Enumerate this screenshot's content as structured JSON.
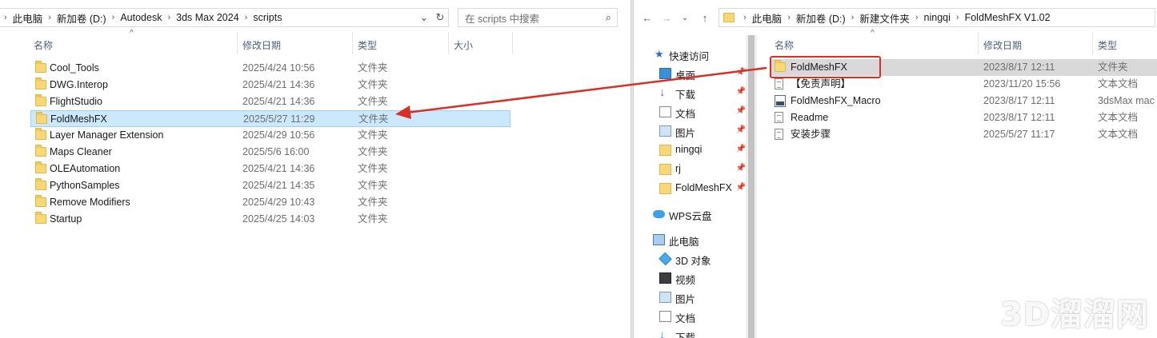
{
  "left": {
    "breadcrumb": [
      "此电脑",
      "新加卷 (D:)",
      "Autodesk",
      "3ds Max 2024",
      "scripts"
    ],
    "search_placeholder": "在 scripts 中搜索",
    "columns": {
      "name": "名称",
      "date": "修改日期",
      "type": "类型",
      "size": "大小"
    },
    "rows": [
      {
        "name": "Cool_Tools",
        "date": "2025/4/24 10:56",
        "type": "文件夹"
      },
      {
        "name": "DWG.Interop",
        "date": "2025/4/21 14:36",
        "type": "文件夹"
      },
      {
        "name": "FlightStudio",
        "date": "2025/4/21 14:36",
        "type": "文件夹"
      },
      {
        "name": "FoldMeshFX",
        "date": "2025/5/27 11:29",
        "type": "文件夹"
      },
      {
        "name": "Layer Manager Extension",
        "date": "2025/4/29 10:56",
        "type": "文件夹"
      },
      {
        "name": "Maps Cleaner",
        "date": "2025/5/6 16:00",
        "type": "文件夹"
      },
      {
        "name": "OLEAutomation",
        "date": "2025/4/21 14:36",
        "type": "文件夹"
      },
      {
        "name": "PythonSamples",
        "date": "2025/4/21 14:35",
        "type": "文件夹"
      },
      {
        "name": "Remove Modifiers",
        "date": "2025/4/29 10:43",
        "type": "文件夹"
      },
      {
        "name": "Startup",
        "date": "2025/4/25 14:03",
        "type": "文件夹"
      }
    ]
  },
  "right": {
    "breadcrumb": [
      "此电脑",
      "新加卷 (D:)",
      "新建文件夹",
      "ningqi",
      "FoldMeshFX V1.02"
    ],
    "columns": {
      "name": "名称",
      "date": "修改日期",
      "type": "类型"
    },
    "nav": {
      "quick_access": "快速访问",
      "pinned": [
        "桌面",
        "下载",
        "文档",
        "图片",
        "ningqi",
        "rj",
        "FoldMeshFX"
      ],
      "wps": "WPS云盘",
      "this_pc": "此电脑",
      "pc_items": [
        "3D 对象",
        "视频",
        "图片",
        "文档",
        "下载"
      ]
    },
    "rows": [
      {
        "name": "FoldMeshFX",
        "date": "2023/8/17 12:11",
        "type": "文件夹",
        "icon": "folder-icon"
      },
      {
        "name": "【免责声明】",
        "date": "2023/11/20 15:56",
        "type": "文本文档",
        "icon": "text-file-icon"
      },
      {
        "name": "FoldMeshFX_Macro",
        "date": "2023/8/17 12:11",
        "type": "3dsMax mac",
        "icon": "maxscript-file-icon"
      },
      {
        "name": "Readme",
        "date": "2023/8/17 12:11",
        "type": "文本文档",
        "icon": "text-file-icon"
      },
      {
        "name": "安装步骤",
        "date": "2025/5/27 11:17",
        "type": "文本文档",
        "icon": "text-file-icon"
      }
    ]
  },
  "watermark": "3D溜溜网",
  "colors": {
    "selection": "#cce8ff",
    "annotation": "#d93025",
    "header_text": "#4c607a"
  }
}
